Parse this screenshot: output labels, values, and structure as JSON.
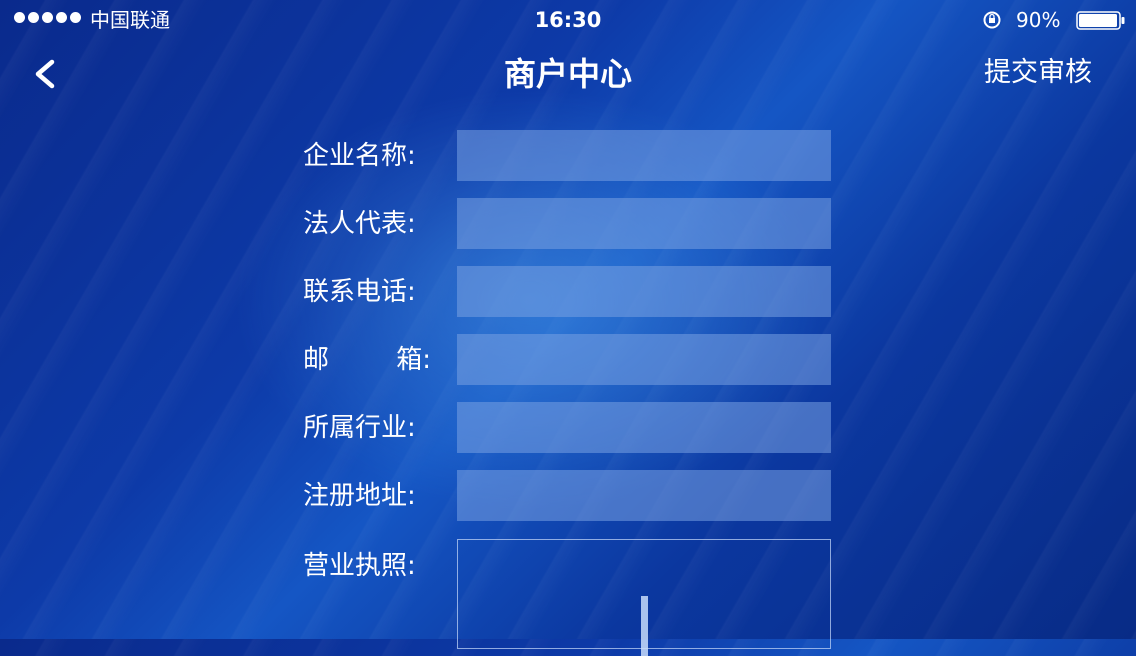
{
  "status_bar": {
    "carrier": "中国联通",
    "time": "16:30",
    "battery_percent": "90%",
    "signal_icon": "signal-dots-icon",
    "rotation_lock_icon": "rotation-lock-icon",
    "battery_icon": "battery-icon"
  },
  "nav": {
    "back_icon": "chevron-left-icon",
    "title": "商户中心",
    "submit_label": "提交审核"
  },
  "form": {
    "fields": [
      {
        "label": "企业名称:",
        "value": ""
      },
      {
        "label": "法人代表:",
        "value": ""
      },
      {
        "label": "联系电话:",
        "value": ""
      },
      {
        "label_left": "邮",
        "label_right": "箱:",
        "value": ""
      },
      {
        "label": "所属行业:",
        "value": ""
      },
      {
        "label": "注册地址:",
        "value": ""
      }
    ],
    "license": {
      "label": "营业执照:",
      "upload_icon": "plus-icon"
    }
  },
  "colors": {
    "background_dark": "#0a2a8c",
    "background_light": "#1556c4",
    "input_fill": "#7aa0e1",
    "text": "#ffffff"
  }
}
